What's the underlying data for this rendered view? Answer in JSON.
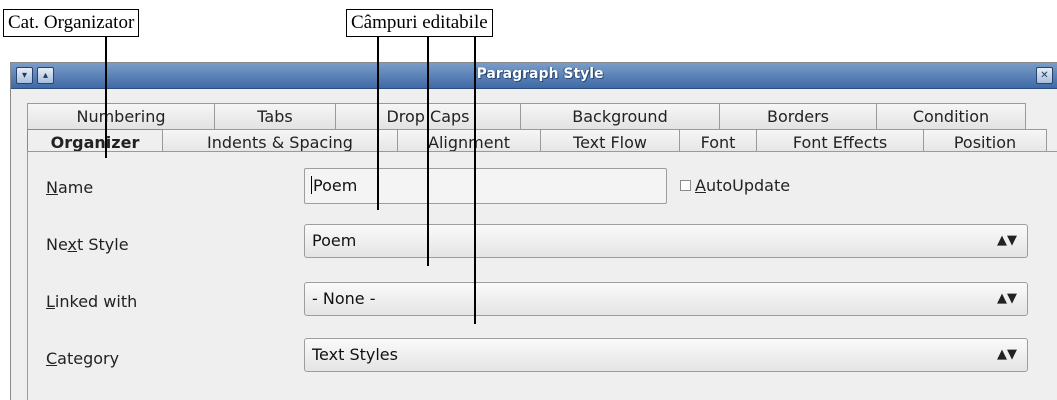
{
  "annotations": {
    "organizer": "Cat. Organizator",
    "editable_fields": "Câmpuri editabile"
  },
  "dialog": {
    "title": "Paragraph Style",
    "title_buttons": [
      "chevron-down-icon",
      "chevron-up-icon",
      "close-icon"
    ]
  },
  "tabs_back": [
    "Numbering",
    "Tabs",
    "Drop Caps",
    "Background",
    "Borders",
    "Condition"
  ],
  "tabs_front": [
    "Organizer",
    "Indents & Spacing",
    "Alignment",
    "Text Flow",
    "Font",
    "Font Effects",
    "Position"
  ],
  "active_tab": "Organizer",
  "form": {
    "name_label_u": "N",
    "name_label_rest": "ame",
    "name_value": "Poem",
    "autoupdate_u": "A",
    "autoupdate_rest": "utoUpdate",
    "next_style_label_a": "Ne",
    "next_style_label_u": "x",
    "next_style_label_b": "t Style",
    "next_style_value": "Poem",
    "linked_label_u": "L",
    "linked_label_rest": "inked with",
    "linked_value": "- None -",
    "category_label_u": "C",
    "category_label_rest": "ategory",
    "category_value": "Text Styles"
  }
}
